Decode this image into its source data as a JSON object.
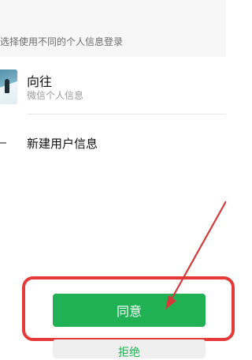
{
  "header": {
    "hint": "选择使用不同的个人信息登录"
  },
  "profiles": [
    {
      "name": "向往",
      "subtitle": "微信个人信息"
    }
  ],
  "new_profile": {
    "label": "新建用户信息"
  },
  "actions": {
    "agree_label": "同意",
    "reject_label": "拒绝"
  },
  "colors": {
    "accent_green": "#1fb154",
    "annotation_red": "#e53a3a"
  }
}
